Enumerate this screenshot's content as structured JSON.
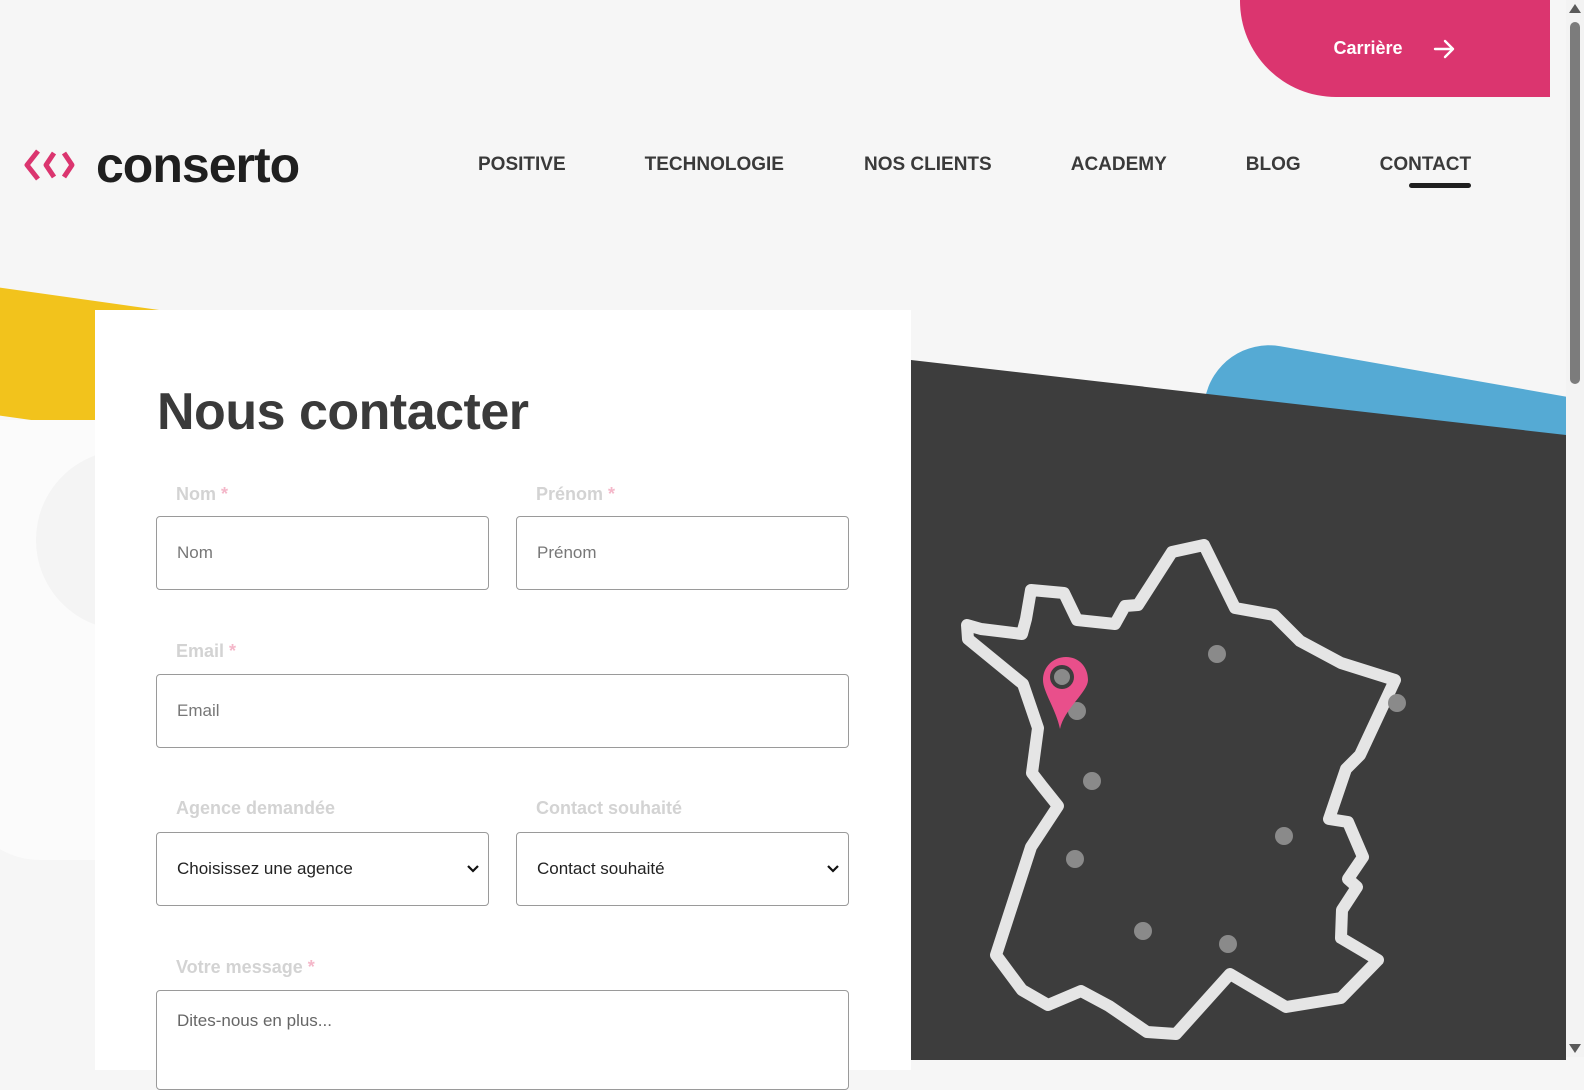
{
  "header": {
    "career_label": "Carrière",
    "logo_text": "conserto",
    "nav": [
      {
        "label": "POSITIVE"
      },
      {
        "label": "TECHNOLOGIE"
      },
      {
        "label": "NOS CLIENTS"
      },
      {
        "label": "ACADEMY"
      },
      {
        "label": "BLOG"
      },
      {
        "label": "CONTACT",
        "active": true
      }
    ]
  },
  "form": {
    "title": "Nous contacter",
    "required_mark": "*",
    "nom": {
      "label": "Nom",
      "placeholder": "Nom",
      "value": ""
    },
    "prenom": {
      "label": "Prénom",
      "placeholder": "Prénom",
      "value": ""
    },
    "email": {
      "label": "Email",
      "placeholder": "Email",
      "value": ""
    },
    "agence": {
      "label": "Agence demandée",
      "selected": "Choisissez une agence"
    },
    "contact": {
      "label": "Contact souhaité",
      "selected": "Contact souhaité"
    },
    "message": {
      "label": "Votre message",
      "placeholder": "Dites-nous en plus..."
    }
  },
  "colors": {
    "brand_pink": "#db356f",
    "accent_yellow": "#f2c31c",
    "accent_blue": "#55aad4",
    "map_bg": "#3d3d3d"
  }
}
